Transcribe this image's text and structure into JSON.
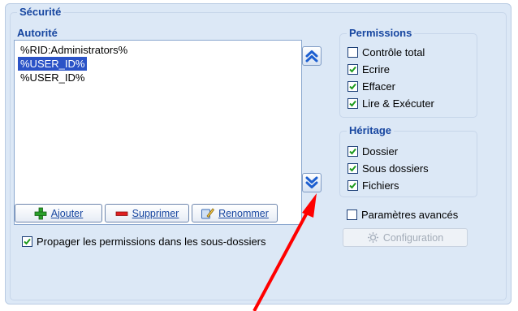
{
  "security": {
    "title": "Sécurité",
    "authority": {
      "title": "Autorité",
      "items": [
        "%RID:Administrators%",
        "%USER_ID%",
        "%USER_ID%"
      ],
      "selected_index": 1
    },
    "buttons": {
      "add": "Ajouter",
      "remove": "Supprimer",
      "rename": "Renommer"
    },
    "propagate": {
      "label": "Propager les permissions dans les sous-dossiers",
      "checked": true
    },
    "permissions": {
      "title": "Permissions",
      "items": [
        {
          "label": "Contrôle total",
          "checked": false
        },
        {
          "label": "Ecrire",
          "checked": true
        },
        {
          "label": "Effacer",
          "checked": true
        },
        {
          "label": "Lire & Exécuter",
          "checked": true
        }
      ]
    },
    "inheritance": {
      "title": "Héritage",
      "items": [
        {
          "label": "Dossier",
          "checked": true
        },
        {
          "label": "Sous dossiers",
          "checked": true
        },
        {
          "label": "Fichiers",
          "checked": true
        }
      ]
    },
    "advanced": {
      "label": "Paramètres avancés",
      "checked": false
    },
    "configuration": {
      "label": "Configuration",
      "enabled": false
    }
  },
  "colors": {
    "panel": "#dce8f6",
    "group_title": "#1746a0",
    "selection": "#2b53c7",
    "annotation_arrow": "#ff0000"
  },
  "icons": {
    "scroll_up": "double-chevron-up-icon",
    "scroll_down": "double-chevron-down-icon",
    "add": "green-plus-icon",
    "remove": "red-minus-icon",
    "rename": "rename-icon",
    "configuration": "gear-icon"
  }
}
